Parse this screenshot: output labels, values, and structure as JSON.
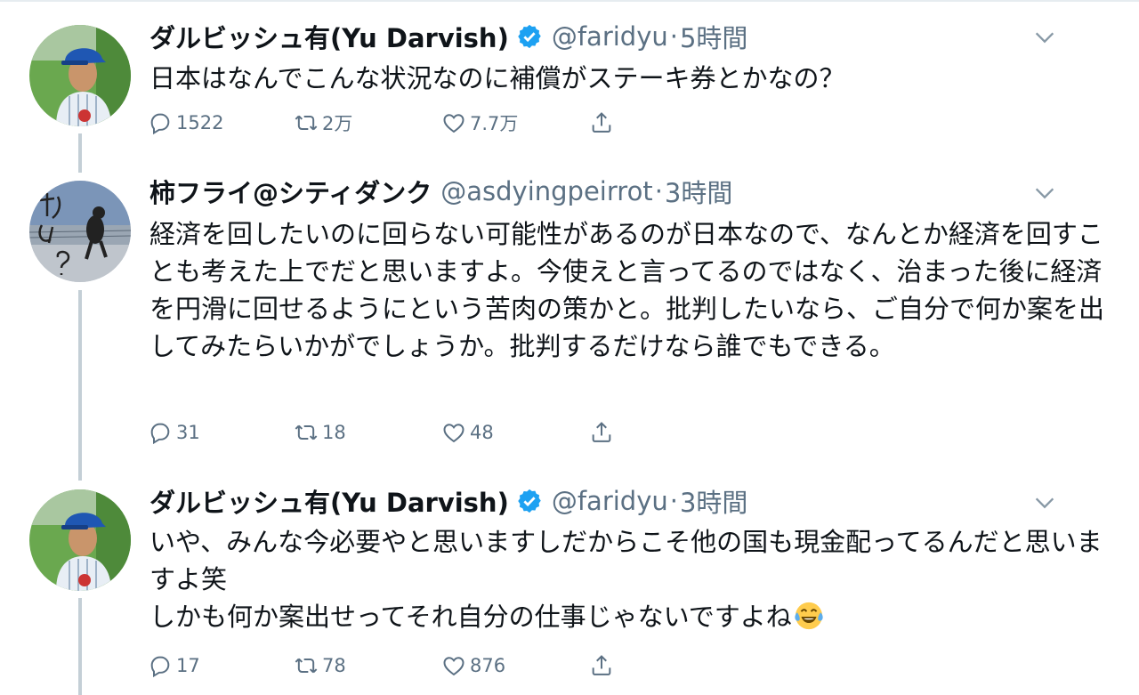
{
  "colors": {
    "text": "#0f1419",
    "secondary": "#5b7083",
    "verified": "#1da1f2",
    "thread_line": "#c4cfd6"
  },
  "tweets": [
    {
      "author_name": "ダルビッシュ有(Yu Darvish)",
      "verified": true,
      "handle": "@faridyu",
      "separator": "·",
      "time": "5時間",
      "text": "日本はなんでこんな状況なのに補償がステーキ券とかなの？",
      "reply_count": "1522",
      "retweet_count": "2万",
      "like_count": "7.7万",
      "avatar": "player-portrait"
    },
    {
      "author_name": "柿フライ@シティダンク",
      "verified": false,
      "handle": "@asdyingpeirrot",
      "separator": "·",
      "time": "3時間",
      "text": "経済を回したいのに回らない可能性があるのが日本なので、なんとか経済を回すことも考えた上でだと思いますよ。今使えと言ってるのではなく、治まった後に経済を円滑に回せるようにという苦肉の策かと。批判したいなら、ご自分で何か案を出してみたらいかがでしょうか。批判するだけなら誰でもできる。",
      "reply_count": "31",
      "retweet_count": "18",
      "like_count": "48",
      "avatar": "cat-photo"
    },
    {
      "author_name": "ダルビッシュ有(Yu Darvish)",
      "verified": true,
      "handle": "@faridyu",
      "separator": "·",
      "time": "3時間",
      "text": "いや、みんな今必要やと思いますしだからこそ他の国も現金配ってるんだと思いますよ笑\nしかも何か案出せってそれ自分の仕事じゃないですよね",
      "emoji": "face-with-tears-of-joy",
      "reply_count": "17",
      "retweet_count": "78",
      "like_count": "876",
      "avatar": "player-portrait"
    }
  ],
  "icons": {
    "reply": "reply-icon",
    "retweet": "retweet-icon",
    "like": "like-icon",
    "share": "share-icon",
    "more": "chevron-down-icon",
    "verified": "verified-badge-icon"
  }
}
